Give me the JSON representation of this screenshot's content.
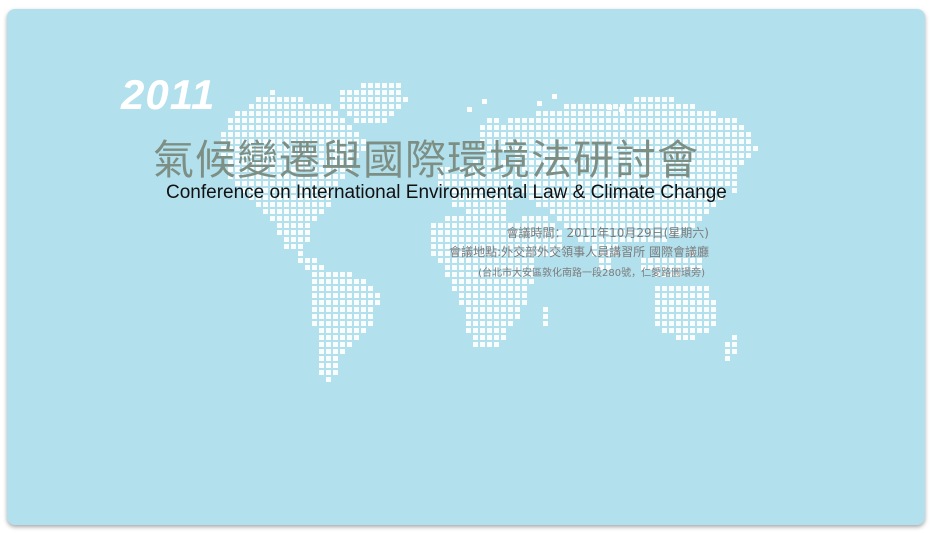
{
  "banner": {
    "year": "2011",
    "title_zh": "氣候變遷與國際環境法研討會",
    "title_en": "Conference on International Environmental Law & Climate Change",
    "time": "會議時間：2011年10月29日(星期六)",
    "venue": "會議地點:外交部外交領事人員講習所  國際會議廳",
    "address": "(台北市大安區敦化南路一段280號，仁愛路圓環旁)"
  },
  "colors": {
    "background": "#b3e0ed",
    "map_dots": "#ffffff",
    "title_zh": "#7d8f84",
    "title_en": "#111111",
    "info_text": "#7b7b7b"
  },
  "decoration": {
    "map": "world-map-dot-grid"
  }
}
